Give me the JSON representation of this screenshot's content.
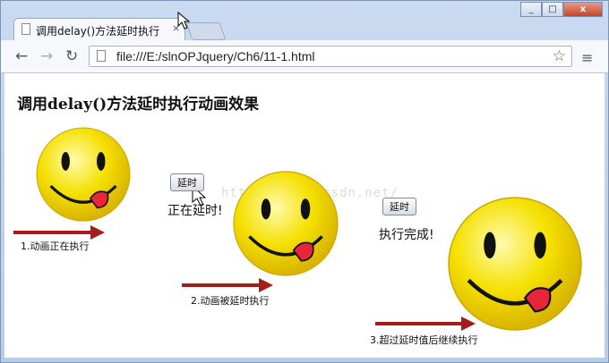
{
  "browser": {
    "tab_title": "调用delay()方法延时执行",
    "tab_close": "×",
    "url": "file:///E:/slnOPJquery/Ch6/11-1.html",
    "window_buttons": {
      "minimize": "_",
      "maximize": "□",
      "close": "x"
    }
  },
  "page": {
    "heading": "调用delay()方法延时执行动画效果",
    "watermark": "http://blog.csdn.net/",
    "panels": [
      {
        "caption": "1.动画正在执行"
      },
      {
        "button_label": "延时",
        "status": "正在延时!",
        "caption": "2.动画被延时执行"
      },
      {
        "button_label": "延时",
        "status": "执行完成!",
        "caption": "3.超过延时值后继续执行"
      }
    ]
  },
  "colors": {
    "smiley": "#f5e000",
    "arrow": "#a51c1c",
    "tongue": "#e8263a"
  },
  "icons": [
    "page-icon",
    "back-arrow-icon",
    "forward-arrow-icon",
    "reload-icon",
    "star-icon",
    "menu-icon",
    "mouse-cursor-icon",
    "smiley-icon"
  ]
}
